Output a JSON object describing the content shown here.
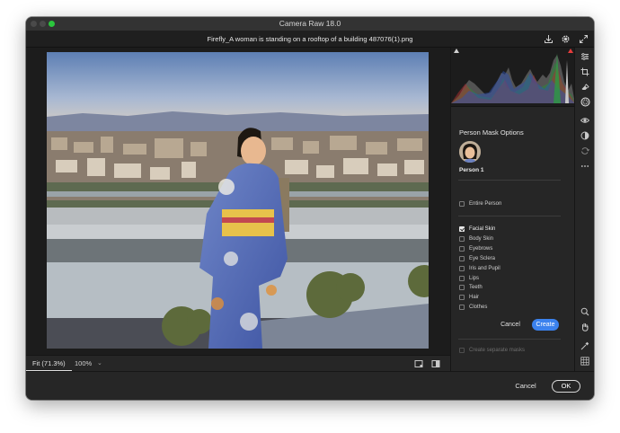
{
  "window": {
    "title": "Camera Raw 18.0",
    "file_name": "Firefly_A woman is standing on a rooftop of a building 487076(1).png"
  },
  "titlebar_icons": [
    "save-icon",
    "gear-icon",
    "expand-icon"
  ],
  "bottom_bar": {
    "fit_label": "Fit (71.3%)",
    "zoom_label": "100%",
    "zoom_caret": "⌄"
  },
  "mask_panel": {
    "title": "Person Mask Options",
    "person_label": "Person 1",
    "entire_person": {
      "label": "Entire Person",
      "checked": false
    },
    "options": [
      {
        "label": "Facial Skin",
        "checked": true
      },
      {
        "label": "Body Skin",
        "checked": false
      },
      {
        "label": "Eyebrows",
        "checked": false
      },
      {
        "label": "Eye Sclera",
        "checked": false
      },
      {
        "label": "Iris and Pupil",
        "checked": false
      },
      {
        "label": "Lips",
        "checked": false
      },
      {
        "label": "Teeth",
        "checked": false
      },
      {
        "label": "Hair",
        "checked": false
      },
      {
        "label": "Clothes",
        "checked": false
      }
    ],
    "cancel_label": "Cancel",
    "create_label": "Create",
    "separate_masks": {
      "label": "Create separate masks",
      "checked": false,
      "disabled": true
    }
  },
  "tools": [
    "edit-sliders-icon",
    "crop-icon",
    "eraser-icon",
    "masking-icon",
    "red-eye-icon",
    "presets-icon",
    "snapshot-icon",
    "more-icon"
  ],
  "bottom_tools": [
    "zoom-icon",
    "hand-icon",
    "color-sampler-icon",
    "grid-icon"
  ],
  "footer": {
    "cancel_label": "Cancel",
    "ok_label": "OK"
  },
  "colors": {
    "accent": "#3b82ee",
    "window_bg": "#262626",
    "clipping_warning": "#e53c3c"
  }
}
